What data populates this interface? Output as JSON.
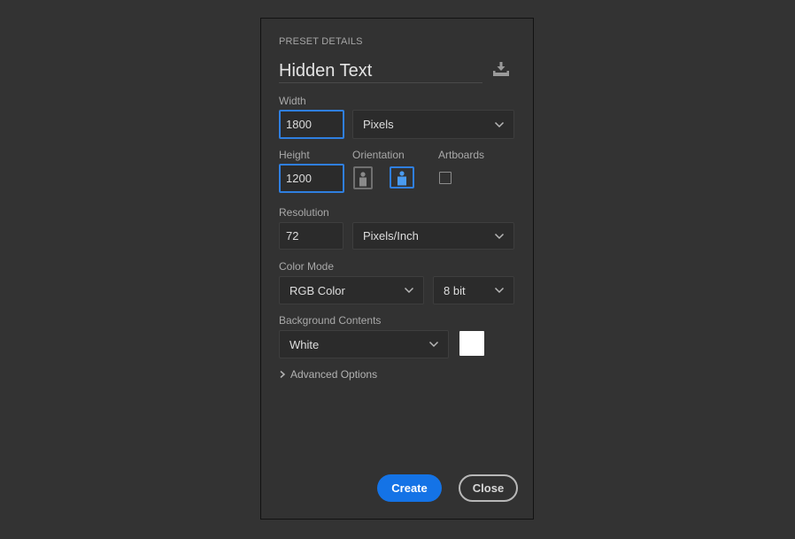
{
  "preset": {
    "section_title": "PRESET DETAILS",
    "name": "Hidden Text",
    "save_icon": "save-preset-icon"
  },
  "width": {
    "label": "Width",
    "value": "1800",
    "unit": "Pixels"
  },
  "height": {
    "label": "Height",
    "value": "1200"
  },
  "orientation": {
    "label": "Orientation",
    "selected": "landscape"
  },
  "artboards": {
    "label": "Artboards",
    "checked": false
  },
  "resolution": {
    "label": "Resolution",
    "value": "72",
    "unit": "Pixels/Inch"
  },
  "color_mode": {
    "label": "Color Mode",
    "mode": "RGB Color",
    "depth": "8 bit"
  },
  "background": {
    "label": "Background Contents",
    "value": "White",
    "swatch_color": "#ffffff"
  },
  "advanced": {
    "label": "Advanced Options"
  },
  "buttons": {
    "create": "Create",
    "close": "Close"
  },
  "colors": {
    "accent": "#1473e6",
    "focus": "#2f7fe0",
    "panel": "#323232"
  }
}
